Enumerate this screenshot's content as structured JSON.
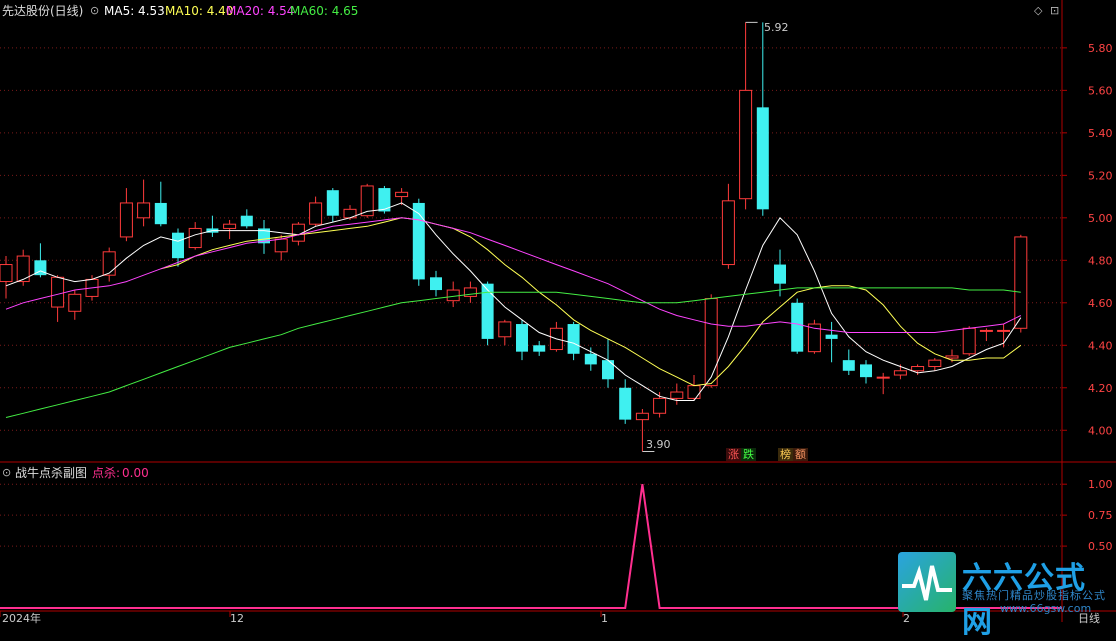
{
  "header": {
    "stock": "先达股份(日线)",
    "ma_labels": [
      {
        "text": "MA5: 4.53",
        "color": "#ffffff"
      },
      {
        "text": "MA10: 4.40",
        "color": "#ffff55"
      },
      {
        "text": "MA20: 4.54",
        "color": "#ff44ff"
      },
      {
        "text": "MA60: 4.65",
        "color": "#44ee44"
      }
    ]
  },
  "sub_header": {
    "title": "战牛点杀副图",
    "indicator_label": "点杀:",
    "indicator_value": "0.00"
  },
  "annotations": {
    "high": "5.92",
    "low": "3.90"
  },
  "tags": [
    {
      "text": "涨",
      "color": "#ff5555"
    },
    {
      "text": "跌",
      "color": "#44ff44"
    },
    {
      "text": "榜",
      "color": "#ffcc55"
    },
    {
      "text": "额",
      "color": "#ff9966"
    }
  ],
  "bottom_axis": {
    "label_year": "2024年",
    "label_m1": "12",
    "label_m2": "1",
    "label_m3": "2",
    "period": "日线"
  },
  "watermark": {
    "title": "六六公式网",
    "subtitle": "聚焦热门精品炒股指标公式",
    "url": "www.66gsw.com"
  },
  "colors": {
    "up": "#ff3b3b",
    "down": "#3ff0f0",
    "grid": "#7a1a1a",
    "axis": "#b00000",
    "ma5": "#ffffff",
    "ma10": "#ffff55",
    "ma20": "#ff44ff",
    "ma60": "#44ee44",
    "sub_line": "#ff2f8f"
  },
  "chart_data": [
    {
      "type": "candlestick",
      "title": "先达股份(日线)",
      "y_ticks": [
        "5.80",
        "5.60",
        "5.40",
        "5.20",
        "5.00",
        "4.80",
        "4.60",
        "4.40",
        "4.20",
        "4.00"
      ],
      "ylim": [
        3.86,
        5.95
      ],
      "candles": [
        {
          "o": 4.7,
          "h": 4.82,
          "l": 4.62,
          "c": 4.78
        },
        {
          "o": 4.7,
          "h": 4.85,
          "l": 4.68,
          "c": 4.82
        },
        {
          "o": 4.8,
          "h": 4.88,
          "l": 4.72,
          "c": 4.73
        },
        {
          "o": 4.58,
          "h": 4.73,
          "l": 4.51,
          "c": 4.72
        },
        {
          "o": 4.56,
          "h": 4.66,
          "l": 4.52,
          "c": 4.64
        },
        {
          "o": 4.63,
          "h": 4.73,
          "l": 4.61,
          "c": 4.71
        },
        {
          "o": 4.73,
          "h": 4.86,
          "l": 4.7,
          "c": 4.84
        },
        {
          "o": 4.91,
          "h": 5.14,
          "l": 4.89,
          "c": 5.07
        },
        {
          "o": 5.0,
          "h": 5.18,
          "l": 4.96,
          "c": 5.07
        },
        {
          "o": 5.07,
          "h": 5.17,
          "l": 4.96,
          "c": 4.97
        },
        {
          "o": 4.93,
          "h": 4.95,
          "l": 4.77,
          "c": 4.81
        },
        {
          "o": 4.86,
          "h": 4.98,
          "l": 4.85,
          "c": 4.95
        },
        {
          "o": 4.95,
          "h": 5.01,
          "l": 4.91,
          "c": 4.93
        },
        {
          "o": 4.95,
          "h": 4.99,
          "l": 4.9,
          "c": 4.97
        },
        {
          "o": 5.01,
          "h": 5.04,
          "l": 4.95,
          "c": 4.96
        },
        {
          "o": 4.95,
          "h": 4.99,
          "l": 4.83,
          "c": 4.88
        },
        {
          "o": 4.84,
          "h": 4.92,
          "l": 4.8,
          "c": 4.9
        },
        {
          "o": 4.89,
          "h": 4.98,
          "l": 4.87,
          "c": 4.97
        },
        {
          "o": 4.97,
          "h": 5.1,
          "l": 4.96,
          "c": 5.07
        },
        {
          "o": 5.13,
          "h": 5.14,
          "l": 4.98,
          "c": 5.01
        },
        {
          "o": 5.0,
          "h": 5.06,
          "l": 4.99,
          "c": 5.04
        },
        {
          "o": 5.01,
          "h": 5.16,
          "l": 5.0,
          "c": 5.15
        },
        {
          "o": 5.14,
          "h": 5.15,
          "l": 5.02,
          "c": 5.03
        },
        {
          "o": 5.1,
          "h": 5.14,
          "l": 5.06,
          "c": 5.12
        },
        {
          "o": 5.07,
          "h": 5.09,
          "l": 4.68,
          "c": 4.71
        },
        {
          "o": 4.72,
          "h": 4.75,
          "l": 4.63,
          "c": 4.66
        },
        {
          "o": 4.61,
          "h": 4.7,
          "l": 4.58,
          "c": 4.66
        },
        {
          "o": 4.63,
          "h": 4.7,
          "l": 4.6,
          "c": 4.67
        },
        {
          "o": 4.69,
          "h": 4.7,
          "l": 4.4,
          "c": 4.43
        },
        {
          "o": 4.44,
          "h": 4.52,
          "l": 4.4,
          "c": 4.51
        },
        {
          "o": 4.5,
          "h": 4.52,
          "l": 4.33,
          "c": 4.37
        },
        {
          "o": 4.4,
          "h": 4.42,
          "l": 4.35,
          "c": 4.37
        },
        {
          "o": 4.38,
          "h": 4.51,
          "l": 4.37,
          "c": 4.48
        },
        {
          "o": 4.5,
          "h": 4.51,
          "l": 4.33,
          "c": 4.36
        },
        {
          "o": 4.36,
          "h": 4.39,
          "l": 4.28,
          "c": 4.31
        },
        {
          "o": 4.33,
          "h": 4.43,
          "l": 4.2,
          "c": 4.24
        },
        {
          "o": 4.2,
          "h": 4.24,
          "l": 4.03,
          "c": 4.05
        },
        {
          "o": 4.05,
          "h": 4.1,
          "l": 3.9,
          "c": 4.08
        },
        {
          "o": 4.08,
          "h": 4.18,
          "l": 4.06,
          "c": 4.15
        },
        {
          "o": 4.15,
          "h": 4.22,
          "l": 4.12,
          "c": 4.18
        },
        {
          "o": 4.15,
          "h": 4.26,
          "l": 4.14,
          "c": 4.21
        },
        {
          "o": 4.21,
          "h": 4.64,
          "l": 4.2,
          "c": 4.62
        },
        {
          "o": 4.78,
          "h": 5.16,
          "l": 4.76,
          "c": 5.08
        },
        {
          "o": 5.09,
          "h": 5.92,
          "l": 5.04,
          "c": 5.6
        },
        {
          "o": 5.52,
          "h": 5.92,
          "l": 5.01,
          "c": 5.04
        },
        {
          "o": 4.78,
          "h": 4.85,
          "l": 4.63,
          "c": 4.69
        },
        {
          "o": 4.6,
          "h": 4.62,
          "l": 4.36,
          "c": 4.37
        },
        {
          "o": 4.37,
          "h": 4.52,
          "l": 4.36,
          "c": 4.5
        },
        {
          "o": 4.45,
          "h": 4.51,
          "l": 4.32,
          "c": 4.43
        },
        {
          "o": 4.33,
          "h": 4.38,
          "l": 4.26,
          "c": 4.28
        },
        {
          "o": 4.31,
          "h": 4.33,
          "l": 4.22,
          "c": 4.25
        },
        {
          "o": 4.25,
          "h": 4.27,
          "l": 4.17,
          "c": 4.25
        },
        {
          "o": 4.26,
          "h": 4.31,
          "l": 4.24,
          "c": 4.28
        },
        {
          "o": 4.28,
          "h": 4.31,
          "l": 4.26,
          "c": 4.3
        },
        {
          "o": 4.3,
          "h": 4.34,
          "l": 4.28,
          "c": 4.33
        },
        {
          "o": 4.34,
          "h": 4.38,
          "l": 4.32,
          "c": 4.35
        },
        {
          "o": 4.36,
          "h": 4.49,
          "l": 4.35,
          "c": 4.48
        },
        {
          "o": 4.47,
          "h": 4.48,
          "l": 4.42,
          "c": 4.47
        },
        {
          "o": 4.47,
          "h": 4.5,
          "l": 4.39,
          "c": 4.47
        },
        {
          "o": 4.48,
          "h": 4.92,
          "l": 4.46,
          "c": 4.91
        }
      ],
      "series": [
        {
          "name": "MA5",
          "values": [
            4.68,
            4.71,
            4.75,
            4.72,
            4.7,
            4.71,
            4.74,
            4.81,
            4.87,
            4.91,
            4.89,
            4.92,
            4.94,
            4.94,
            4.94,
            4.94,
            4.93,
            4.92,
            4.96,
            4.98,
            5.0,
            5.03,
            5.04,
            5.07,
            5.02,
            4.92,
            4.83,
            4.75,
            4.66,
            4.58,
            4.52,
            4.46,
            4.43,
            4.41,
            4.37,
            4.33,
            4.26,
            4.21,
            4.16,
            4.14,
            4.14,
            4.25,
            4.44,
            4.66,
            4.87,
            5.0,
            4.92,
            4.75,
            4.55,
            4.44,
            4.37,
            4.33,
            4.3,
            4.27,
            4.28,
            4.3,
            4.34,
            4.38,
            4.41,
            4.53
          ]
        },
        {
          "name": "MA10",
          "values": [
            null,
            null,
            null,
            null,
            null,
            null,
            null,
            null,
            null,
            4.76,
            4.78,
            4.82,
            4.85,
            4.87,
            4.89,
            4.9,
            4.91,
            4.92,
            4.93,
            4.94,
            4.95,
            4.96,
            4.98,
            5.0,
            4.99,
            4.97,
            4.95,
            4.91,
            4.85,
            4.78,
            4.72,
            4.65,
            4.59,
            4.52,
            4.47,
            4.43,
            4.39,
            4.34,
            4.29,
            4.25,
            4.21,
            4.22,
            4.3,
            4.4,
            4.51,
            4.58,
            4.65,
            4.67,
            4.68,
            4.68,
            4.66,
            4.59,
            4.49,
            4.41,
            4.36,
            4.33,
            4.33,
            4.34,
            4.34,
            4.4
          ]
        },
        {
          "name": "MA20",
          "values": [
            4.57,
            4.6,
            4.62,
            4.64,
            4.66,
            4.67,
            4.68,
            4.7,
            4.73,
            4.76,
            4.79,
            4.82,
            4.84,
            4.86,
            4.88,
            4.89,
            4.9,
            4.92,
            4.94,
            4.96,
            4.97,
            4.98,
            4.99,
            5.0,
            4.99,
            4.97,
            4.95,
            4.93,
            4.9,
            4.87,
            4.84,
            4.81,
            4.78,
            4.75,
            4.72,
            4.69,
            4.65,
            4.61,
            4.57,
            4.54,
            4.52,
            4.5,
            4.49,
            4.49,
            4.5,
            4.51,
            4.5,
            4.48,
            4.47,
            4.46,
            4.46,
            4.46,
            4.46,
            4.46,
            4.46,
            4.47,
            4.48,
            4.49,
            4.5,
            4.54
          ]
        },
        {
          "name": "MA60",
          "values": [
            4.06,
            4.08,
            4.1,
            4.12,
            4.14,
            4.16,
            4.18,
            4.21,
            4.24,
            4.27,
            4.3,
            4.33,
            4.36,
            4.39,
            4.41,
            4.43,
            4.45,
            4.48,
            4.5,
            4.52,
            4.54,
            4.56,
            4.58,
            4.6,
            4.61,
            4.62,
            4.63,
            4.64,
            4.65,
            4.65,
            4.65,
            4.65,
            4.65,
            4.64,
            4.63,
            4.62,
            4.61,
            4.6,
            4.6,
            4.6,
            4.61,
            4.62,
            4.63,
            4.64,
            4.65,
            4.66,
            4.67,
            4.67,
            4.67,
            4.67,
            4.67,
            4.67,
            4.67,
            4.67,
            4.67,
            4.67,
            4.66,
            4.66,
            4.66,
            4.65
          ]
        }
      ]
    },
    {
      "type": "line",
      "title": "战牛点杀副图",
      "y_ticks": [
        "1.00",
        "0.75",
        "0.50"
      ],
      "ylim": [
        0,
        1.05
      ],
      "series": [
        {
          "name": "点杀",
          "values": [
            0,
            0,
            0,
            0,
            0,
            0,
            0,
            0,
            0,
            0,
            0,
            0,
            0,
            0,
            0,
            0,
            0,
            0,
            0,
            0,
            0,
            0,
            0,
            0,
            0,
            0,
            0,
            0,
            0,
            0,
            0,
            0,
            0,
            0,
            0,
            0,
            0,
            1,
            0,
            0,
            0,
            0,
            0,
            0,
            0,
            0,
            0,
            0,
            0,
            0,
            0,
            0,
            0,
            0,
            0,
            0,
            0,
            0,
            0,
            0
          ]
        }
      ]
    }
  ]
}
